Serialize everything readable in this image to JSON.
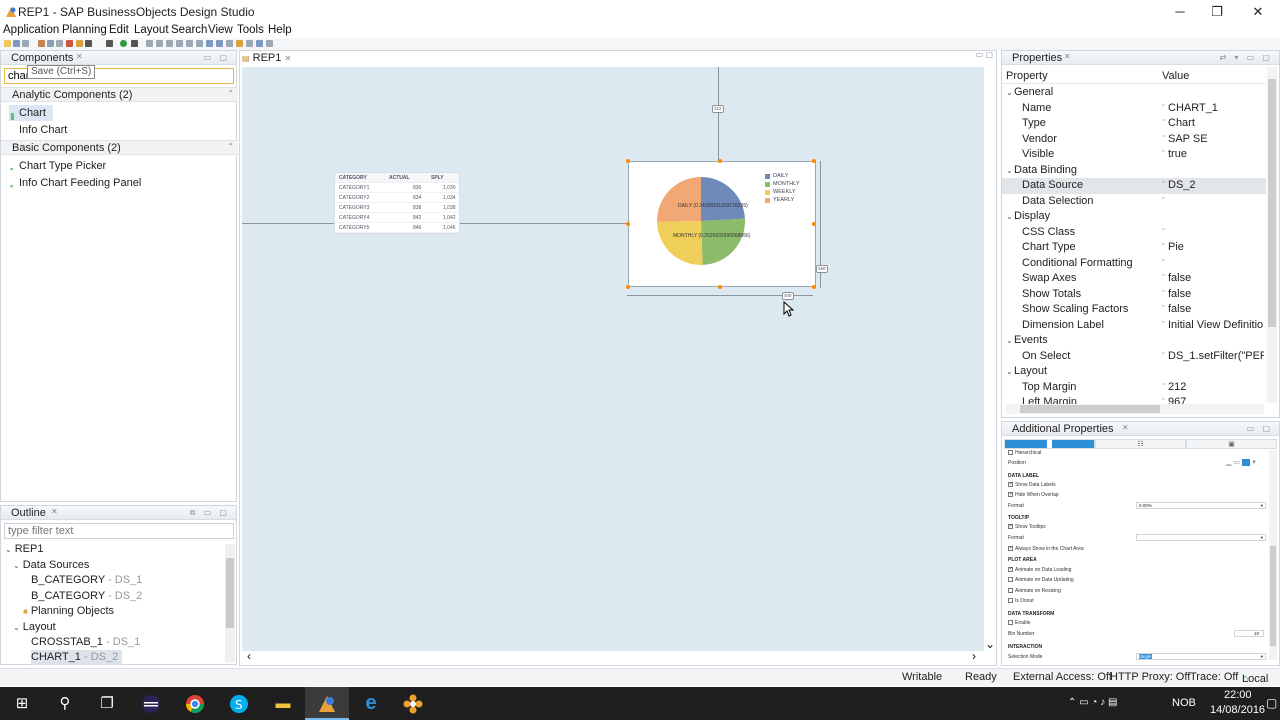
{
  "window": {
    "title": "REP1 - SAP BusinessObjects Design Studio",
    "minimize_glyph": "─",
    "maximize_glyph": "❐",
    "close_glyph": "✕"
  },
  "menubar": {
    "items": [
      "Application",
      "Planning",
      "Edit",
      "Layout",
      "Search",
      "View",
      "Tools",
      "Help"
    ]
  },
  "components_panel": {
    "title": "Components",
    "search_value": "chart",
    "tooltip": "Save (Ctrl+S)",
    "groups": [
      {
        "label": "Analytic Components (2)",
        "items": [
          "Chart",
          "Info Chart"
        ]
      },
      {
        "label": "Basic Components (2)",
        "items": [
          "Chart Type Picker",
          "Info Chart Feeding Panel"
        ]
      }
    ]
  },
  "outline_panel": {
    "title": "Outline",
    "filter_placeholder": "type filter text",
    "tree": {
      "root": "REP1",
      "data_sources": "Data Sources",
      "ds1_name": "B_CATEGORY",
      "ds1_sub": "- DS_1",
      "ds2_name": "B_CATEGORY",
      "ds2_sub": "- DS_2",
      "planning": "Planning Objects",
      "layout": "Layout",
      "crosstab_name": "CROSSTAB_1",
      "crosstab_sub": "- DS_1",
      "chart_name": "CHART_1",
      "chart_sub": "- DS_2"
    }
  },
  "editor": {
    "tab_label": "REP1",
    "measures": {
      "top": "212",
      "left": "967",
      "width": "400",
      "height": "260"
    },
    "crosstab": {
      "headers": [
        "CATEGORY",
        "ACTUAL",
        "SPLY"
      ],
      "rows": [
        [
          "CATEGORY1",
          "830",
          "1,030"
        ],
        [
          "CATEGORY2",
          "834",
          "1,034"
        ],
        [
          "CATEGORY3",
          "838",
          "1,038"
        ],
        [
          "CATEGORY4",
          "842",
          "1,042"
        ],
        [
          "CATEGORY5",
          "846",
          "1,046"
        ]
      ]
    }
  },
  "chart_data": {
    "type": "pie",
    "categories": [
      "DAILY",
      "MONTHLY",
      "WEEKLY",
      "YEARLY"
    ],
    "values": [
      0.2416,
      0.2526,
      0.2529,
      0.2529
    ],
    "data_labels": [
      "DAILY (0.24166911933178226)",
      "MONTHLY (0.2525632995568856)"
    ],
    "colors": [
      "#6e8ab8",
      "#8cbc6a",
      "#f0ce5a",
      "#f2a874"
    ],
    "legend_position": "top-right"
  },
  "properties_panel": {
    "title": "Properties",
    "col_property": "Property",
    "col_value": "Value",
    "rows": [
      {
        "section": true,
        "name": "General"
      },
      {
        "name": "Name",
        "value": "CHART_1"
      },
      {
        "name": "Type",
        "value": "Chart"
      },
      {
        "name": "Vendor",
        "value": "SAP SE"
      },
      {
        "name": "Visible",
        "value": "true"
      },
      {
        "section": true,
        "name": "Data Binding"
      },
      {
        "name": "Data Source",
        "value": "DS_2",
        "selected": true
      },
      {
        "name": "Data Selection",
        "value": ""
      },
      {
        "section": true,
        "name": "Display"
      },
      {
        "name": "CSS Class",
        "value": ""
      },
      {
        "name": "Chart Type",
        "value": "Pie"
      },
      {
        "name": "Conditional Formatting",
        "value": ""
      },
      {
        "name": "Swap Axes",
        "value": "false"
      },
      {
        "name": "Show Totals",
        "value": "false"
      },
      {
        "name": "Show Scaling Factors",
        "value": "false"
      },
      {
        "name": "Dimension Label",
        "value": "Initial View Definitio"
      },
      {
        "section": true,
        "name": "Events"
      },
      {
        "name": "On Select",
        "value": "DS_1.setFilter(\"PERIO"
      },
      {
        "section": true,
        "name": "Layout"
      },
      {
        "name": "Top Margin",
        "value": "212"
      },
      {
        "name": "Left Margin",
        "value": "967"
      }
    ]
  },
  "additional_properties": {
    "title": "Additional Properties",
    "tabs": [
      "▐▌",
      "☷",
      "▣"
    ],
    "hierarchical": "Hierarchical",
    "position": "Position",
    "data_label_head": "DATA LABEL",
    "show_data_labels": "Show Data Labels",
    "hide_when_overlap": "Hide When Overlap",
    "format": "Format",
    "format_value": "0.00%",
    "tooltip_head": "TOOLTIP",
    "show_tooltips": "Show Tooltips",
    "tooltip_format": "Format",
    "always_show": "Always Show in the Chart Area",
    "plot_area_head": "PLOT AREA",
    "animate_loading": "Animate on Data Loading",
    "animate_updating": "Animate on Data Updating",
    "animate_resizing": "Animate on Resizing",
    "is_donut": "Is Donut",
    "data_transform_head": "DATA TRANSFORM",
    "enable": "Enable",
    "bin_number": "Bin Number",
    "bin_number_value": "10",
    "interaction_head": "INTERACTION",
    "selection_mode": "Selection Mode",
    "selection_mode_value": "Single"
  },
  "statusbar": {
    "writable": "Writable",
    "ready": "Ready",
    "external_access": "External Access: Off",
    "http_proxy": "HTTP Proxy: Off",
    "trace": "Trace: Off",
    "local": "Local"
  },
  "taskbar": {
    "lang": "NOB",
    "time": "22:00",
    "date": "14/08/2016",
    "start_glyph": "⊞",
    "search_glyph": "⚲",
    "taskview_glyph": "❐",
    "edge_glyph": "e",
    "explorer_glyph": "▬",
    "tray_glyphs": "⌃  ▭  ◔  ♪  ▤"
  }
}
